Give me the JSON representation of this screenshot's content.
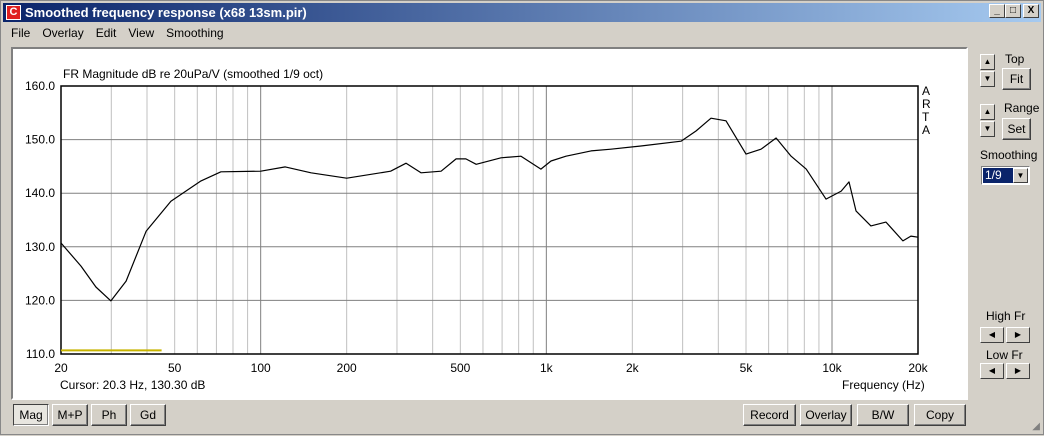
{
  "window": {
    "title": "Smoothed frequency response (x68 13sm.pir)",
    "min": "_",
    "max": "□",
    "close": "X"
  },
  "menu": [
    "File",
    "Overlay",
    "Edit",
    "View",
    "Smoothing"
  ],
  "plot": {
    "title": "FR Magnitude dB re 20uPa/V (smoothed 1/9 oct)",
    "brand": [
      "A",
      "R",
      "T",
      "A"
    ],
    "cursor": "Cursor: 20.3 Hz, 130.30 dB",
    "xlabel": "Frequency (Hz)"
  },
  "right": {
    "top_label": "Top",
    "fit": "Fit",
    "range_label": "Range",
    "set": "Set",
    "smoothing_label": "Smoothing",
    "smoothing_value": "1/9",
    "high_fr": "High Fr",
    "low_fr": "Low Fr"
  },
  "bottom_left": [
    "Mag",
    "M+P",
    "Ph",
    "Gd"
  ],
  "bottom_right": [
    "Record",
    "Overlay",
    "B/W",
    "Copy"
  ],
  "colors": {
    "curve": "#000000",
    "marker": "#c8b400",
    "grid_major": "#808080",
    "grid_minor": "#c0c0c0"
  },
  "chart_data": {
    "type": "line",
    "xscale": "log",
    "xlim": [
      20,
      20000
    ],
    "ylim": [
      110,
      160
    ],
    "yticks": [
      "110.0",
      "120.0",
      "130.0",
      "140.0",
      "150.0",
      "160.0"
    ],
    "xticks": [
      {
        "v": 20,
        "l": "20"
      },
      {
        "v": 50,
        "l": "50"
      },
      {
        "v": 100,
        "l": "100"
      },
      {
        "v": 200,
        "l": "200"
      },
      {
        "v": 500,
        "l": "500"
      },
      {
        "v": 1000,
        "l": "1k"
      },
      {
        "v": 2000,
        "l": "2k"
      },
      {
        "v": 5000,
        "l": "5k"
      },
      {
        "v": 10000,
        "l": "10k"
      },
      {
        "v": 20000,
        "l": "20k"
      }
    ],
    "series": [
      {
        "name": "FR magnitude",
        "x": [
          20,
          23.5,
          26.5,
          29.9,
          33.8,
          39.7,
          48.5,
          61.8,
          72.6,
          100,
          122,
          150,
          200,
          285,
          323,
          364,
          428,
          483,
          523,
          568,
          694,
          815,
          957,
          1038,
          1172,
          1433,
          1683,
          2143,
          2960,
          3340,
          3770,
          4255,
          5000,
          5640,
          6370,
          7190,
          8120,
          9530,
          10770,
          11470,
          12130,
          13680,
          15450,
          17710,
          18880,
          20000
        ],
        "y": [
          130.7,
          126.4,
          122.5,
          119.9,
          123.6,
          132.9,
          138.5,
          142.3,
          144.0,
          144.1,
          144.9,
          143.8,
          142.8,
          144.1,
          145.6,
          143.8,
          144.1,
          146.4,
          146.4,
          145.4,
          146.6,
          146.9,
          144.5,
          146.0,
          146.9,
          147.9,
          148.2,
          148.8,
          149.7,
          151.6,
          154.0,
          153.5,
          147.3,
          148.2,
          150.3,
          146.9,
          144.5,
          138.9,
          140.4,
          142.1,
          136.7,
          133.9,
          134.6,
          131.1,
          132.0,
          131.8
        ]
      },
      {
        "name": "marker",
        "x": [
          20,
          45
        ],
        "y": [
          110.5,
          110.5
        ]
      }
    ]
  }
}
